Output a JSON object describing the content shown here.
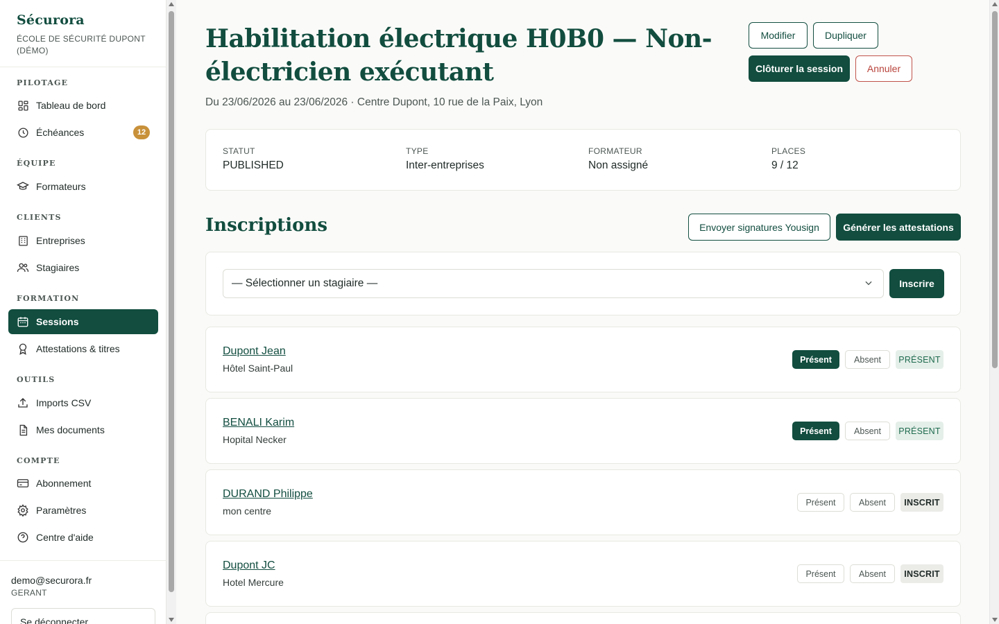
{
  "app": {
    "name": "Sécurora",
    "org": "ÉCOLE DE SÉCURITÉ DUPONT (DÉMO)"
  },
  "sidebar": {
    "sections": [
      {
        "title": "PILOTAGE",
        "items": [
          {
            "label": "Tableau de bord",
            "icon": "grid-icon"
          },
          {
            "label": "Échéances",
            "icon": "clock-icon",
            "badge": "12"
          }
        ]
      },
      {
        "title": "ÉQUIPE",
        "items": [
          {
            "label": "Formateurs",
            "icon": "graduation-cap-icon"
          }
        ]
      },
      {
        "title": "CLIENTS",
        "items": [
          {
            "label": "Entreprises",
            "icon": "building-icon"
          },
          {
            "label": "Stagiaires",
            "icon": "users-icon"
          }
        ]
      },
      {
        "title": "FORMATION",
        "items": [
          {
            "label": "Sessions",
            "icon": "calendar-icon",
            "active": true
          },
          {
            "label": "Attestations & titres",
            "icon": "award-icon"
          }
        ]
      },
      {
        "title": "OUTILS",
        "items": [
          {
            "label": "Imports CSV",
            "icon": "upload-icon"
          },
          {
            "label": "Mes documents",
            "icon": "document-icon"
          }
        ]
      },
      {
        "title": "COMPTE",
        "items": [
          {
            "label": "Abonnement",
            "icon": "credit-card-icon"
          },
          {
            "label": "Paramètres",
            "icon": "gear-icon"
          },
          {
            "label": "Centre d'aide",
            "icon": "help-circle-icon"
          }
        ]
      }
    ],
    "user": {
      "email": "demo@securora.fr",
      "role": "GERANT",
      "logout_label": "Se déconnecter"
    }
  },
  "header": {
    "title": "Habilitation électrique H0B0 — Non-électricien exécutant",
    "subtitle": "Du 23/06/2026 au 23/06/2026 · Centre Dupont, 10 rue de la Paix, Lyon",
    "actions": {
      "edit": "Modifier",
      "duplicate": "Dupliquer",
      "close_session": "Clôturer la session",
      "cancel": "Annuler"
    }
  },
  "summary": [
    {
      "label": "STATUT",
      "value": "PUBLISHED"
    },
    {
      "label": "TYPE",
      "value": "Inter-entreprises"
    },
    {
      "label": "FORMATEUR",
      "value": "Non assigné"
    },
    {
      "label": "PLACES",
      "value": "9 / 12"
    }
  ],
  "inscriptions": {
    "title": "Inscriptions",
    "send_signatures": "Envoyer signatures Yousign",
    "generate_attestations": "Générer les attestations",
    "select_placeholder": "— Sélectionner un stagiaire —",
    "enroll_label": "Inscrire",
    "present_label": "Présent",
    "absent_label": "Absent",
    "rows": [
      {
        "name": "Dupont Jean",
        "org": "Hôtel Saint-Paul",
        "status": "PRÉSENT",
        "present": true
      },
      {
        "name": "BENALI Karim",
        "org": "Hopital Necker",
        "status": "PRÉSENT",
        "present": true
      },
      {
        "name": "DURAND Philippe",
        "org": "mon centre",
        "status": "INSCRIT",
        "present": false
      },
      {
        "name": "Dupont JC",
        "org": "Hotel Mercure",
        "status": "INSCRIT",
        "present": false
      }
    ]
  },
  "colors": {
    "brand": "#124d3f",
    "accent_badge": "#c8913a",
    "danger": "#b8433b"
  }
}
